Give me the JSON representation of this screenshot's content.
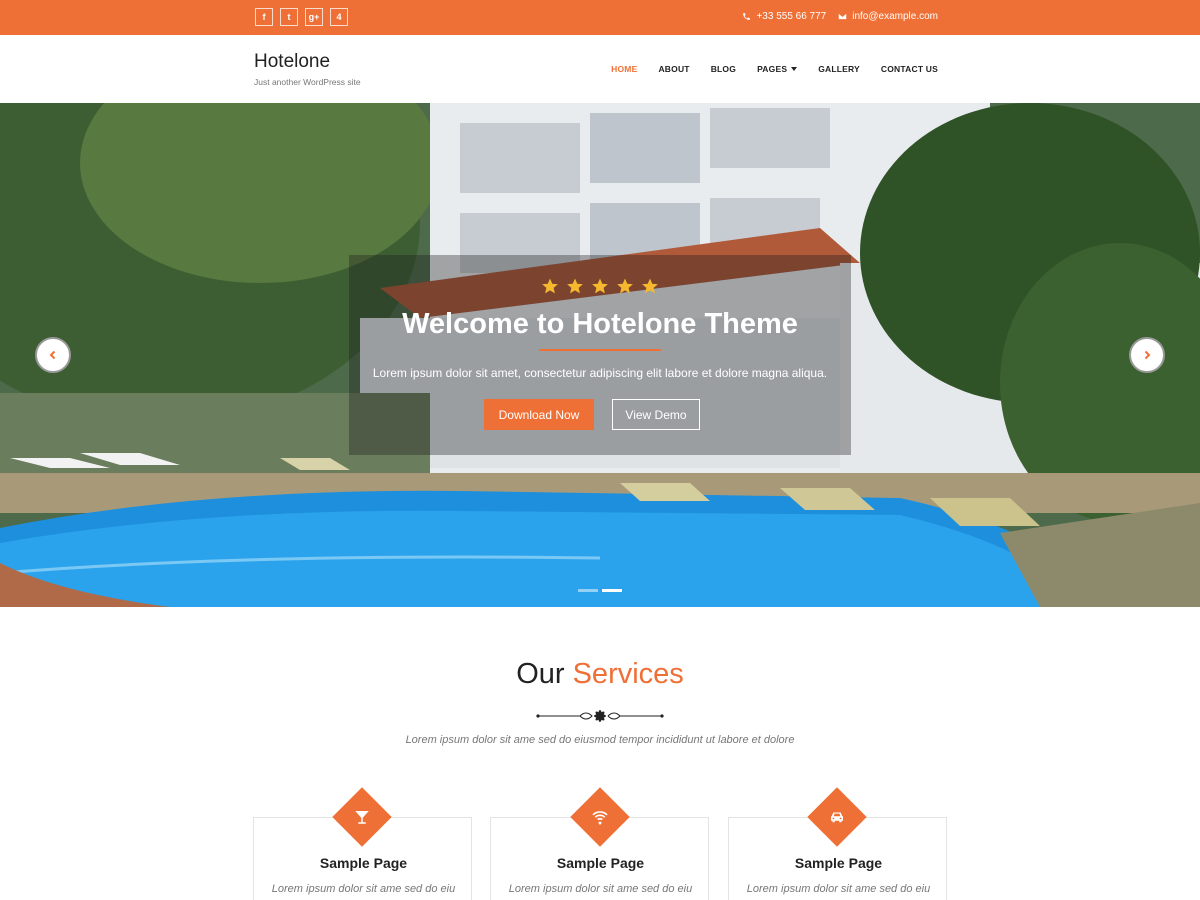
{
  "topbar": {
    "social": [
      {
        "icon": "facebook-icon",
        "glyph": "f"
      },
      {
        "icon": "twitter-icon",
        "glyph": "t"
      },
      {
        "icon": "google-plus-icon",
        "glyph": "g+"
      },
      {
        "icon": "foursquare-icon",
        "glyph": "4"
      }
    ],
    "phone": "+33 555 66 777",
    "email": "info@example.com"
  },
  "header": {
    "site_title": "Hotelone",
    "tagline": "Just another WordPress site",
    "nav": [
      {
        "label": "HOME",
        "active": true
      },
      {
        "label": "ABOUT",
        "active": false
      },
      {
        "label": "BLOG",
        "active": false
      },
      {
        "label": "PAGES",
        "active": false,
        "has_dropdown": true
      },
      {
        "label": "GALLERY",
        "active": false
      },
      {
        "label": "CONTACT US",
        "active": false
      }
    ]
  },
  "hero": {
    "rating_stars": 5,
    "title": "Welcome to Hotelone Theme",
    "subtitle": "Lorem ipsum dolor sit amet, consectetur adipiscing elit labore et dolore magna aliqua.",
    "primary_button": "Download Now",
    "secondary_button": "View Demo",
    "slide_count": 2,
    "active_slide": 1
  },
  "services": {
    "title_plain": "Our",
    "title_accent": "Services",
    "subtitle": "Lorem ipsum dolor sit ame sed do eiusmod tempor incididunt ut labore et dolore",
    "cards": [
      {
        "icon": "cocktail-icon",
        "title": "Sample Page",
        "text": "Lorem ipsum dolor sit ame sed do eiu"
      },
      {
        "icon": "wifi-icon",
        "title": "Sample Page",
        "text": "Lorem ipsum dolor sit ame sed do eiu"
      },
      {
        "icon": "car-icon",
        "title": "Sample Page",
        "text": "Lorem ipsum dolor sit ame sed do eiu"
      }
    ]
  },
  "colors": {
    "accent": "#ef7036",
    "star": "#f5b82e"
  }
}
